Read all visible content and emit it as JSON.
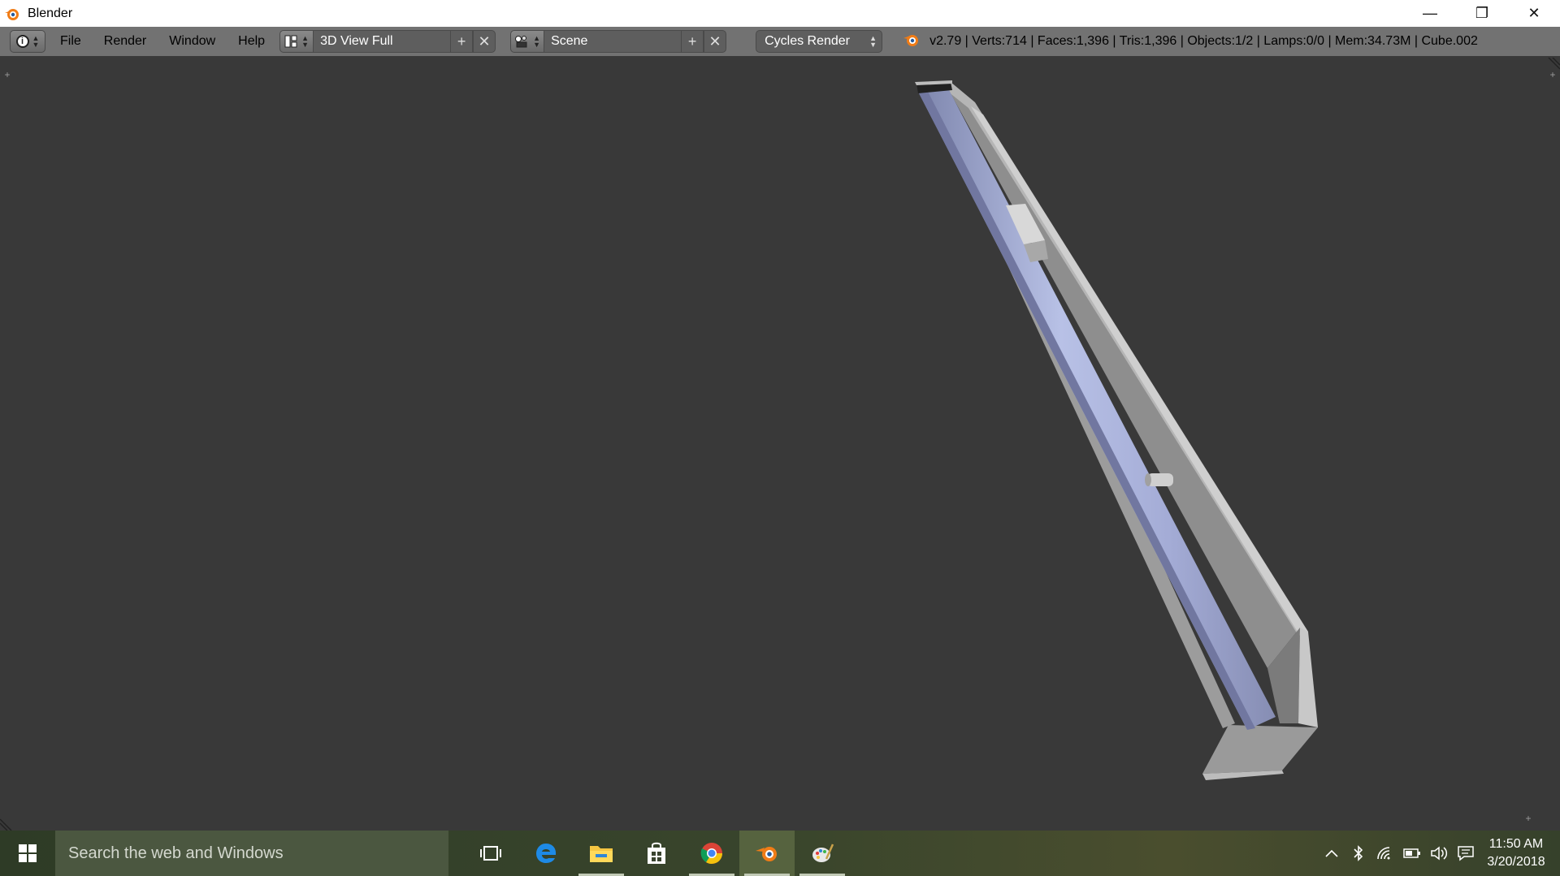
{
  "window": {
    "title": "Blender",
    "controls": {
      "minimize": "—",
      "restore": "❐",
      "close": "✕"
    }
  },
  "header": {
    "menus": [
      "File",
      "Render",
      "Window",
      "Help"
    ],
    "layout": {
      "value": "3D View Full",
      "add": "+",
      "remove": "✕"
    },
    "scene": {
      "value": "Scene",
      "add": "+",
      "remove": "✕"
    },
    "render_engine": "Cycles Render",
    "stats": "v2.79 | Verts:714 | Faces:1,396 | Tris:1,396 | Objects:1/2 | Lamps:0/0 | Mem:34.73M | Cube.002"
  },
  "viewport": {
    "background": "#393939",
    "mesh_colors": {
      "cylinder": "#a9b2d8",
      "trough": "#a9a9a9",
      "trough_dark": "#7b7b7b"
    }
  },
  "taskbar": {
    "search_placeholder": "Search the web and Windows",
    "apps": [
      "task-view",
      "edge",
      "file-explorer",
      "store",
      "chrome",
      "blender",
      "paint"
    ],
    "active_app": "blender",
    "clock_time": "11:50 AM",
    "clock_date": "3/20/2018"
  },
  "colors": {
    "titlebar": "#ffffff",
    "header": "#727272",
    "field": "#5e5e5e",
    "blender_orange": "#f07c16",
    "taskbar": "#36412b"
  }
}
